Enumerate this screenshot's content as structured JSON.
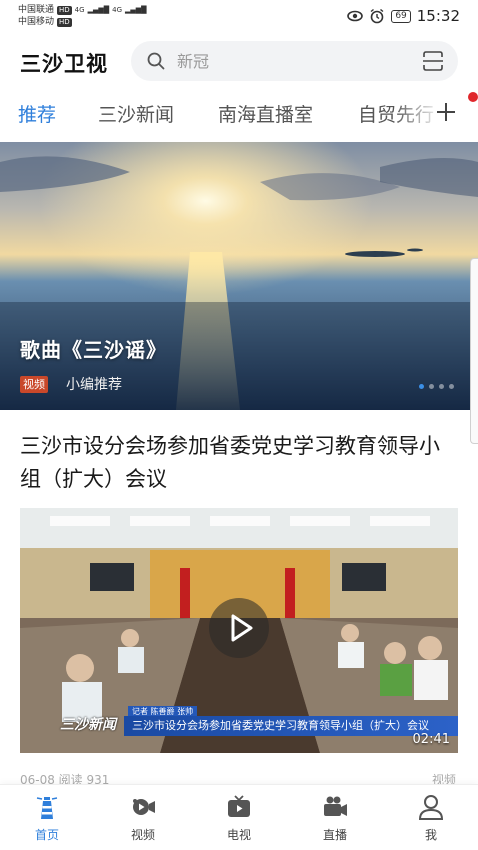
{
  "status_bar": {
    "carrier1": "中国联通",
    "carrier2": "中国移动",
    "hd": "HD",
    "signal1": "4G",
    "signal2": "4G",
    "battery": "69",
    "time": "15:32"
  },
  "header": {
    "app_title": "三沙卫视",
    "search_placeholder": "新冠"
  },
  "tabs": [
    {
      "label": "推荐",
      "active": true
    },
    {
      "label": "三沙新闻",
      "active": false
    },
    {
      "label": "南海直播室",
      "active": false
    },
    {
      "label": "自贸先行",
      "active": false
    }
  ],
  "banner": {
    "title": "歌曲《三沙谣》",
    "badge": "视频",
    "source": "小编推荐",
    "dot_count": 4,
    "active_dot": 0
  },
  "article": {
    "title": "三沙市设分会场参加省委党史学习教育领导小组（扩大）会议",
    "caption_logo": "三沙新闻",
    "caption_reporter": "记者 陈善爵 张帅",
    "caption_text": "三沙市设分会场参加省委党史学习教育领导小组（扩大）会议",
    "duration": "02:41",
    "meta_left": "06-08  阅读 931",
    "meta_right": "视频"
  },
  "bottom_nav": [
    {
      "label": "首页",
      "icon": "lighthouse-icon",
      "active": true
    },
    {
      "label": "视频",
      "icon": "video-camera-icon",
      "active": false
    },
    {
      "label": "电视",
      "icon": "tv-icon",
      "active": false
    },
    {
      "label": "直播",
      "icon": "live-camera-icon",
      "active": false
    },
    {
      "label": "我",
      "icon": "user-icon",
      "active": false
    }
  ],
  "colors": {
    "accent": "#2f7fdb",
    "badge": "#c9482a",
    "notification_dot": "#e0262b"
  }
}
